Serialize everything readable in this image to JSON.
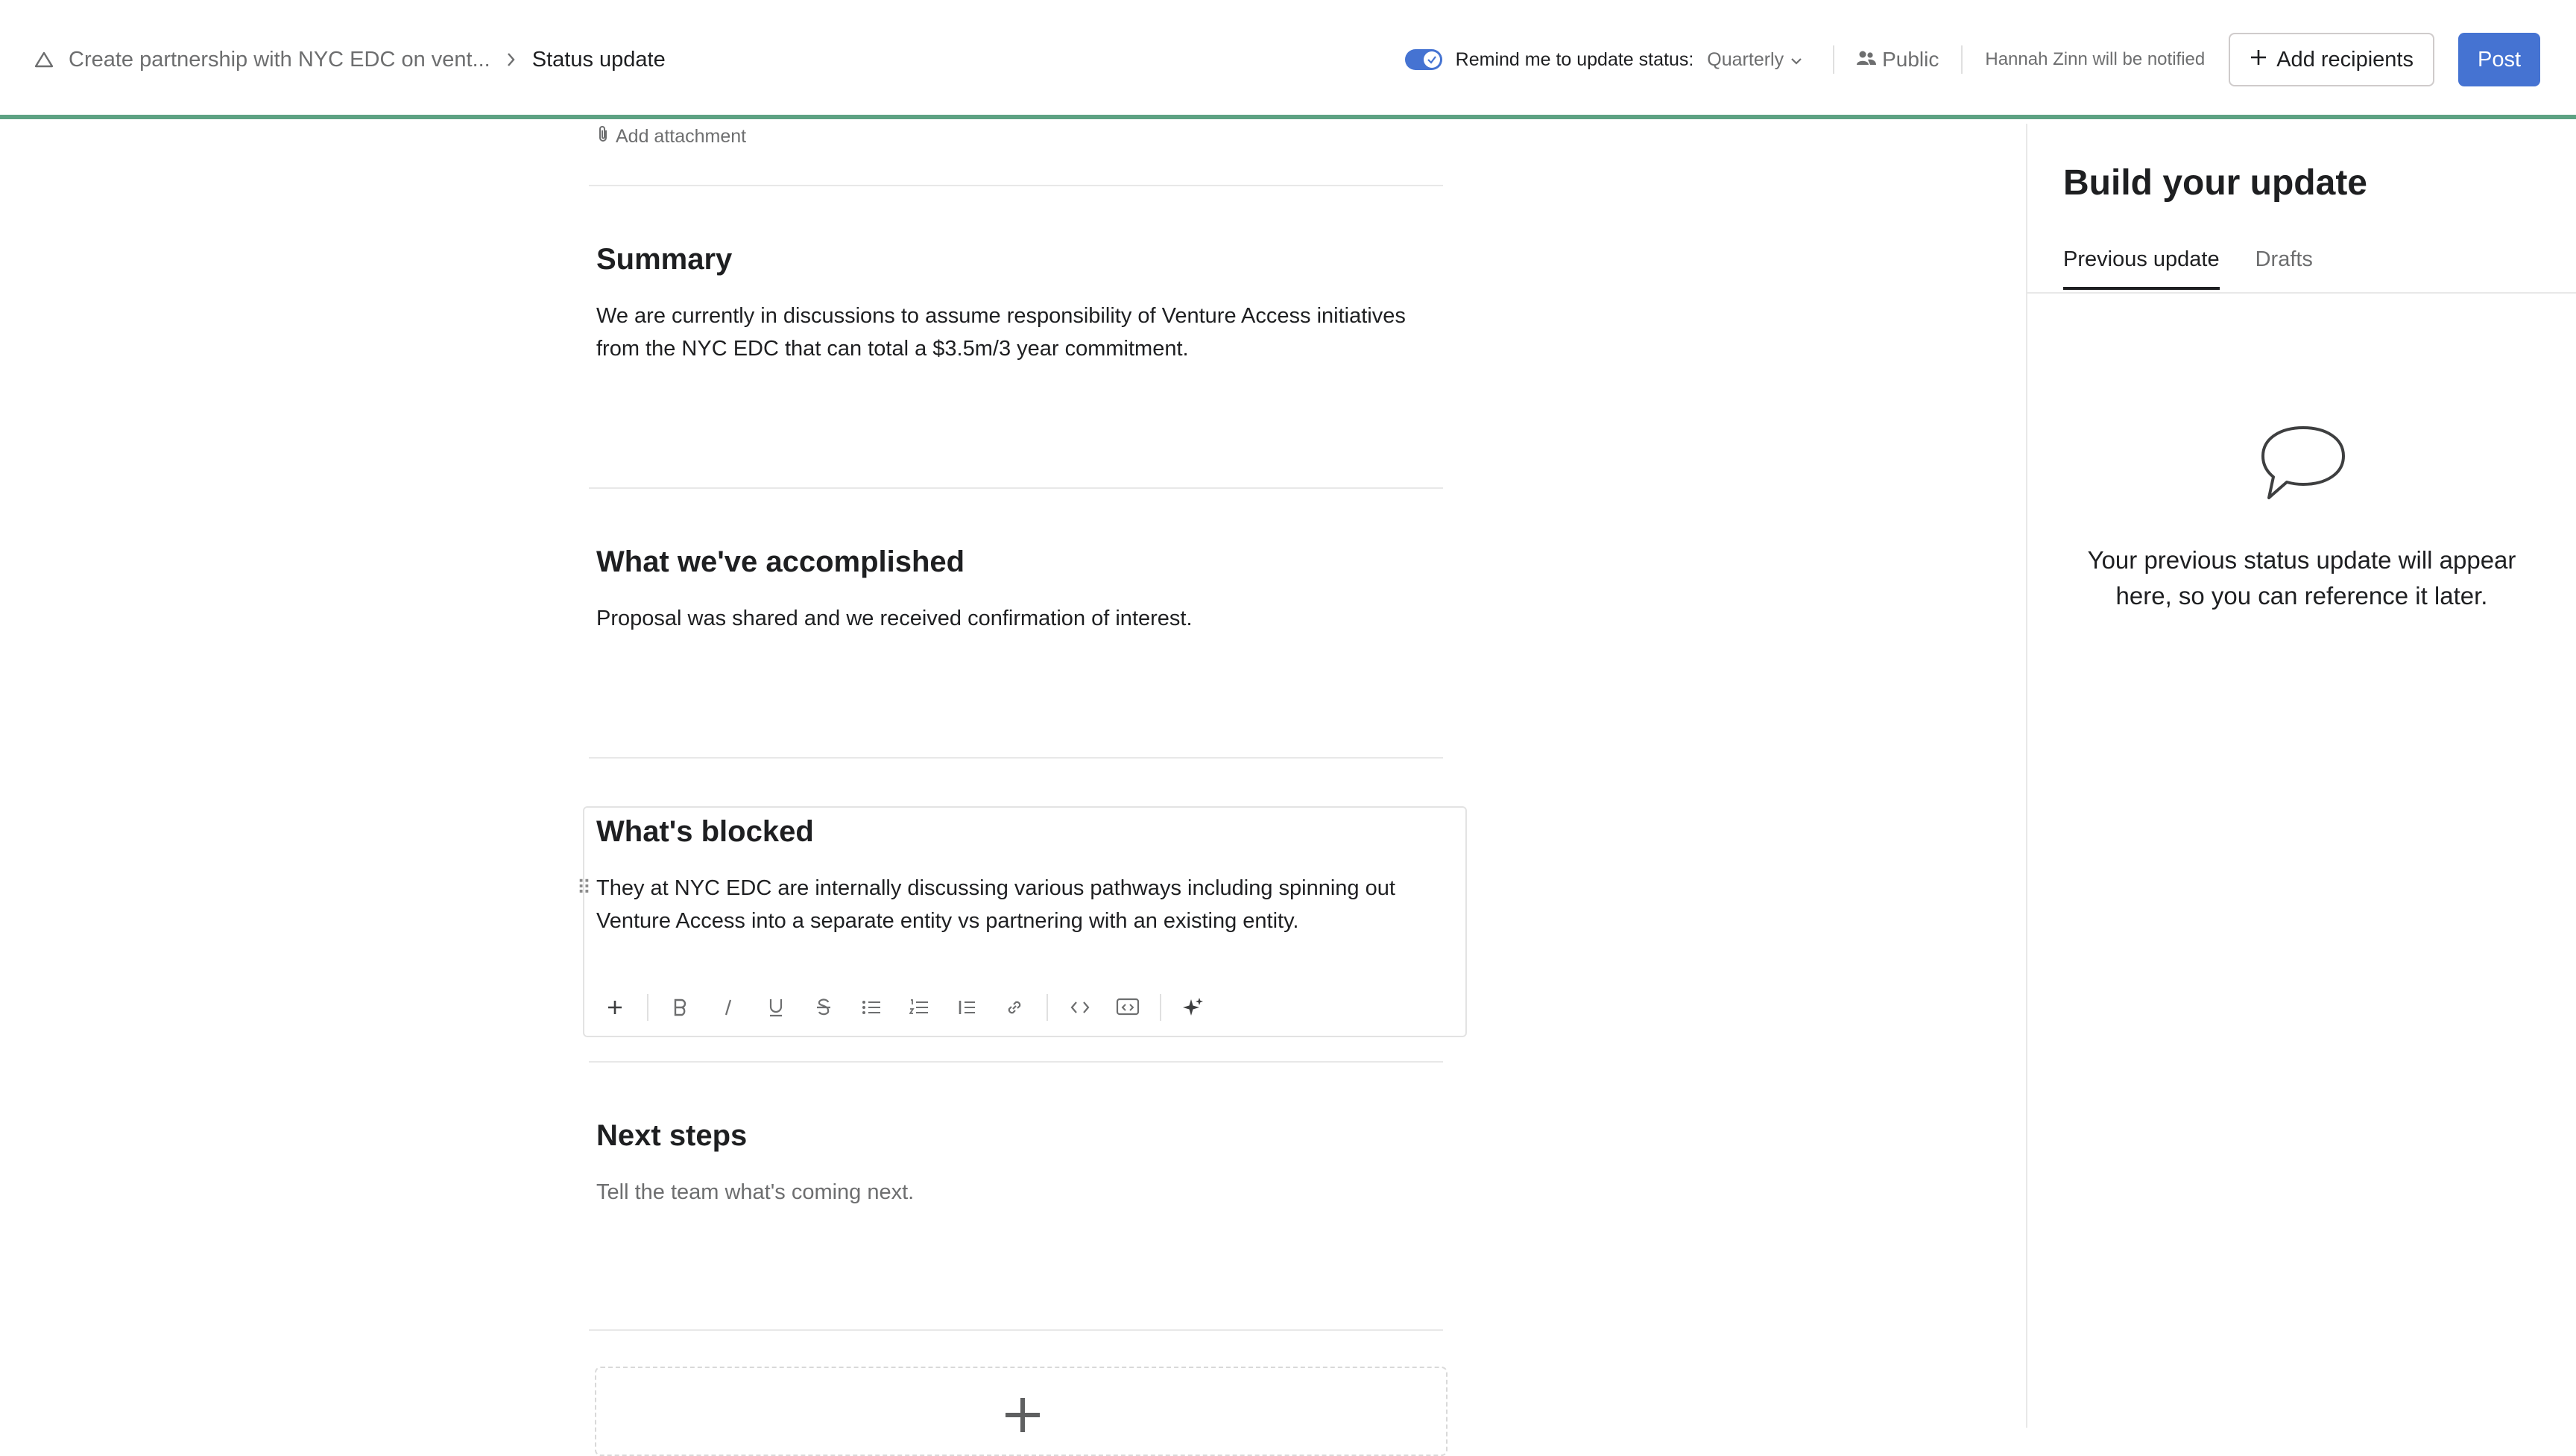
{
  "header": {
    "breadcrumb_project": "Create partnership with NYC EDC on vent...",
    "breadcrumb_current": "Status update",
    "remind_label": "Remind me to update status:",
    "remind_frequency": "Quarterly",
    "visibility": "Public",
    "notified_text": "Hannah Zinn will be notified",
    "add_recipients_label": "Add recipients",
    "post_label": "Post"
  },
  "editor": {
    "add_attachment_label": "Add attachment",
    "sections": [
      {
        "title": "Summary",
        "body": "We are currently in discussions to assume responsibility of Venture Access initiatives from the NYC EDC that can total a $3.5m/3 year commitment."
      },
      {
        "title": "What we've accomplished",
        "body": "Proposal was shared and we received confirmation of interest."
      },
      {
        "title": "What's blocked",
        "body": "They at NYC EDC are internally discussing various pathways including spinning out Venture Access into a separate entity vs partnering with an existing entity."
      },
      {
        "title": "Next steps",
        "placeholder": "Tell the team what's coming next."
      }
    ],
    "toolbar_icons": [
      "plus-icon",
      "bold-icon",
      "italic-icon",
      "underline-icon",
      "strikethrough-icon",
      "bullet-list-icon",
      "numbered-list-icon",
      "quote-icon",
      "link-icon",
      "code-icon",
      "embed-icon",
      "sparkle-icon"
    ]
  },
  "panel": {
    "title": "Build your update",
    "tabs": [
      "Previous update",
      "Drafts"
    ],
    "empty_message": "Your previous status update will appear here, so you can reference it later."
  },
  "colors": {
    "accent": "#4573d2",
    "status_bar": "#5da283",
    "text": "#1e1f21",
    "muted": "#6d6e6f"
  }
}
